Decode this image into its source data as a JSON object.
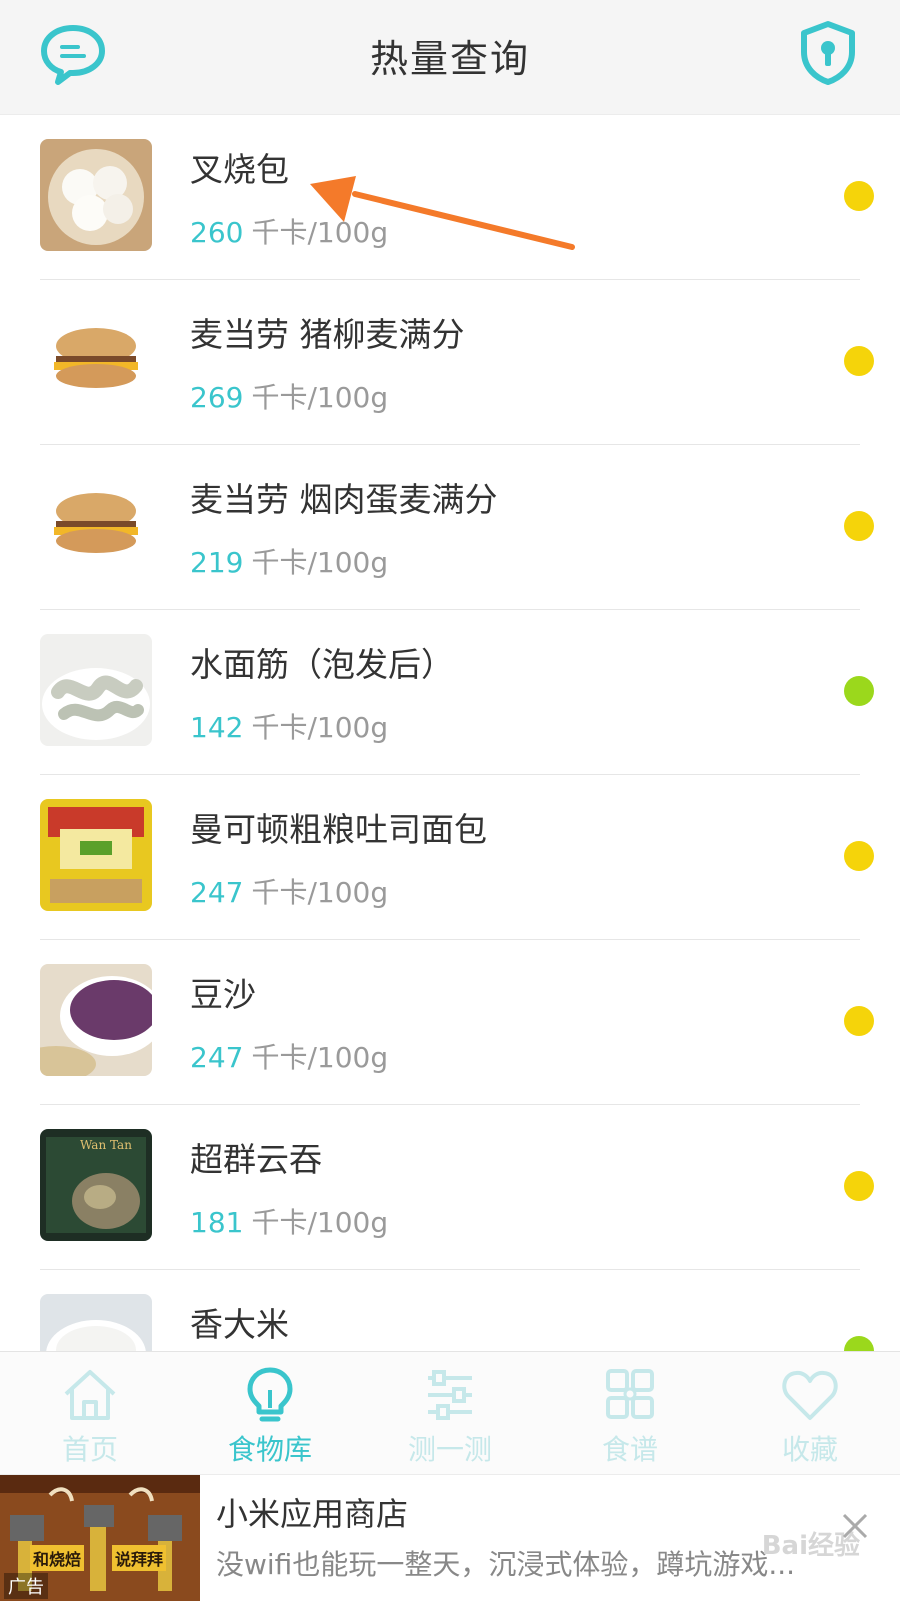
{
  "header": {
    "title": "热量查询",
    "left_icon": "message-icon",
    "right_icon": "shield-lock-icon",
    "accent": "#3ac5cc"
  },
  "foods": [
    {
      "name": "叉烧包",
      "kcal": "260",
      "unit": "千卡/100g",
      "dot": "#f5d40a",
      "thumb": "steamed-buns"
    },
    {
      "name": "麦当劳 猪柳麦满分",
      "kcal": "269",
      "unit": "千卡/100g",
      "dot": "#f5d40a",
      "thumb": "muffin-sandwich"
    },
    {
      "name": "麦当劳 烟肉蛋麦满分",
      "kcal": "219",
      "unit": "千卡/100g",
      "dot": "#f5d40a",
      "thumb": "muffin-sandwich"
    },
    {
      "name": "水面筋（泡发后）",
      "kcal": "142",
      "unit": "千卡/100g",
      "dot": "#9bd81c",
      "thumb": "gluten"
    },
    {
      "name": "曼可顿粗粮吐司面包",
      "kcal": "247",
      "unit": "千卡/100g",
      "dot": "#f5d40a",
      "thumb": "bread-package"
    },
    {
      "name": "豆沙",
      "kcal": "247",
      "unit": "千卡/100g",
      "dot": "#f5d40a",
      "thumb": "bean-paste"
    },
    {
      "name": "超群云吞",
      "kcal": "181",
      "unit": "千卡/100g",
      "dot": "#f5d40a",
      "thumb": "wonton-package"
    },
    {
      "name": "香大米",
      "kcal": "",
      "unit": "",
      "dot": "#9bd81c",
      "thumb": "rice"
    }
  ],
  "tabs": [
    {
      "label": "首页",
      "icon": "home-icon",
      "active": false
    },
    {
      "label": "食物库",
      "icon": "lightbulb-icon",
      "active": true
    },
    {
      "label": "测一测",
      "icon": "sliders-icon",
      "active": false
    },
    {
      "label": "食谱",
      "icon": "grid-icon",
      "active": false
    },
    {
      "label": "收藏",
      "icon": "heart-icon",
      "active": false
    }
  ],
  "colors": {
    "active_tab": "#3ac5cc",
    "inactive_tab": "#c6e8ea"
  },
  "ad": {
    "title": "小米应用商店",
    "description": "没wifi也能玩一整天，沉浸式体验，蹲坑游戏...",
    "tag": "广告",
    "image_text_left": "和烧焙",
    "image_text_right": "说拜拜",
    "watermark": "Bai经验"
  }
}
